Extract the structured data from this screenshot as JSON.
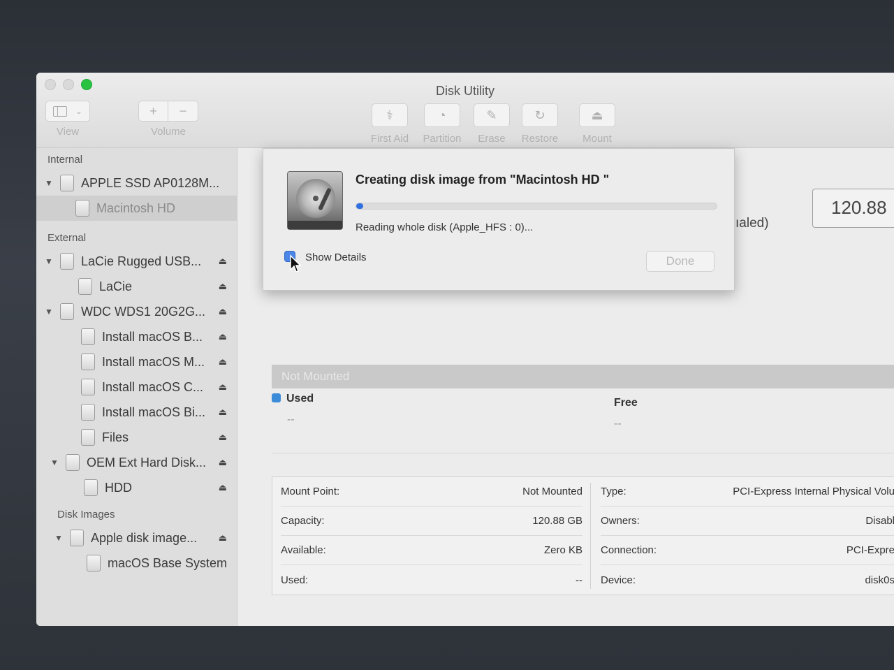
{
  "window": {
    "title": "Disk Utility"
  },
  "toolbar": {
    "view_label": "View",
    "volume_label": "Volume",
    "actions": [
      {
        "label": "First Aid",
        "icon": "stethoscope-icon"
      },
      {
        "label": "Partition",
        "icon": "pie-chart-icon"
      },
      {
        "label": "Erase",
        "icon": "erase-icon"
      },
      {
        "label": "Restore",
        "icon": "restore-icon"
      },
      {
        "label": "Mount",
        "icon": "mount-icon"
      }
    ]
  },
  "sidebar": {
    "internal_header": "Internal",
    "external_header": "External",
    "images_header": "Disk Images",
    "internal": [
      {
        "label": "APPLE SSD AP0128M..."
      },
      {
        "label": "Macintosh HD"
      }
    ],
    "external": [
      {
        "label": "LaCie Rugged USB..."
      },
      {
        "label": "LaCie"
      },
      {
        "label": "WDC WDS1 20G2G..."
      },
      {
        "label": "Install macOS B..."
      },
      {
        "label": "Install macOS M..."
      },
      {
        "label": "Install macOS C..."
      },
      {
        "label": "Install macOS Bi..."
      },
      {
        "label": "Files"
      },
      {
        "label": "OEM Ext Hard Disk..."
      },
      {
        "label": "HDD"
      }
    ],
    "images": [
      {
        "label": "Apple disk image..."
      },
      {
        "label": "macOS Base System"
      }
    ],
    "eject_glyph": "⏏"
  },
  "main": {
    "capacity_value": "120.88",
    "scaled_partial": "ıaled)",
    "status_strip": "Not Mounted",
    "used_label": "Used",
    "used_value": "--",
    "free_label": "Free",
    "free_value": "--",
    "info_left": [
      {
        "key": "Mount Point:",
        "value": "Not Mounted"
      },
      {
        "key": "Capacity:",
        "value": "120.88 GB"
      },
      {
        "key": "Available:",
        "value": "Zero KB"
      },
      {
        "key": "Used:",
        "value": "--"
      }
    ],
    "info_right": [
      {
        "key": "Type:",
        "value": "PCI-Express Internal Physical Volu"
      },
      {
        "key": "Owners:",
        "value": "Disabl"
      },
      {
        "key": "Connection:",
        "value": "PCI-Expre"
      },
      {
        "key": "Device:",
        "value": "disk0s"
      }
    ],
    "used_color": "#3b8bd8"
  },
  "dialog": {
    "title": "Creating disk image from \"Macintosh HD \"",
    "status": "Reading whole disk (Apple_HFS : 0)...",
    "details_label": "Show Details",
    "done_label": "Done",
    "progress_percent": 2,
    "progress_color": "#2f6fe0"
  }
}
